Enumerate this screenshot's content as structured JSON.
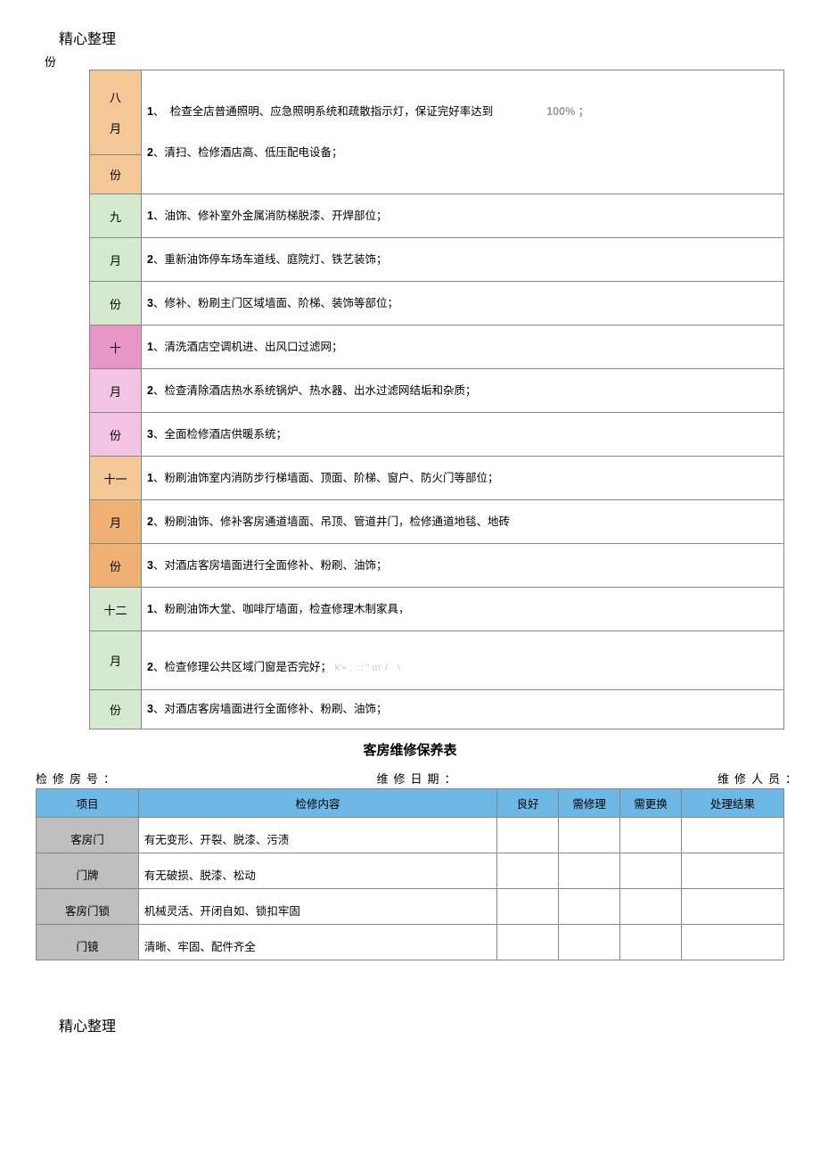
{
  "header": "精心整理",
  "stray_text": "份",
  "schedule": [
    {
      "month_parts": [
        "八",
        "月",
        "份"
      ],
      "colors": [
        "c-orange",
        "c-orange",
        "c-orange"
      ],
      "lines": [
        "1、　检查全店普通照明、应急照明系统和疏散指示灯，保证完好率达到",
        "2、清扫、检修酒店高、低压配电设备；"
      ],
      "pct": "100% ；",
      "layout": "two-row"
    },
    {
      "month_parts": [
        "九",
        "月",
        "份"
      ],
      "colors": [
        "c-green",
        "c-green",
        "c-green"
      ],
      "lines": [
        "1、油饰、修补室外金属消防梯脱漆、开焊部位；",
        "2、重新油饰停车场车道线、庭院灯、铁艺装饰；",
        "3、修补、粉刷主门区域墙面、阶梯、装饰等部位；"
      ],
      "layout": "three-row"
    },
    {
      "month_parts": [
        "十",
        "月",
        "份"
      ],
      "colors": [
        "c-pink",
        "c-pink2",
        "c-pink2"
      ],
      "lines": [
        "1、清洗酒店空调机进、出风口过滤网；",
        "2、检查清除酒店热水系统锅炉、热水器、出水过滤网结垢和杂质；",
        "3、全面检修酒店供暖系统；"
      ],
      "layout": "three-row"
    },
    {
      "month_parts": [
        "十一",
        "月",
        "份"
      ],
      "colors": [
        "c-orange",
        "c-dkorange",
        "c-dkorange"
      ],
      "lines": [
        "1、粉刷油饰室内消防步行梯墙面、顶面、阶梯、窗户、防火门等部位；",
        "2、粉刷油饰、修补客房通道墙面、吊顶、管道井门，检修通道地毯、地砖",
        "3、对酒店客房墙面进行全面修补、粉刷、油饰；"
      ],
      "layout": "three-row"
    },
    {
      "month_parts": [
        "十二",
        "月",
        "份"
      ],
      "colors": [
        "c-green",
        "c-green",
        "c-green"
      ],
      "lines": [
        "1、粉刷油饰大堂、咖啡厅墙面，检查修理木制家具，",
        "2、检查修理公共区域门窗是否完好；",
        "3、对酒店客房墙面进行全面修补、粉刷、油饰；"
      ],
      "layout": "three-row-merge"
    }
  ],
  "table2_title": "客房维修保养表",
  "info_labels": {
    "room": "检修房号：",
    "date": "维修日期：",
    "staff": "维修人员："
  },
  "repair_headers": [
    "项目",
    "检修内容",
    "良好",
    "需修理",
    "需更换",
    "处理结果"
  ],
  "repair_rows": [
    {
      "item": "客房门",
      "content": "有无变形、开裂、脱漆、污渍"
    },
    {
      "item": "门牌",
      "content": "有无破损、脱漆、松动"
    },
    {
      "item": "客房门锁",
      "content": "机械灵活、开闭自如、锁扣牢固"
    },
    {
      "item": "门镜",
      "content": "清晰、牢固、配件齐全"
    }
  ],
  "footer": "精心整理"
}
